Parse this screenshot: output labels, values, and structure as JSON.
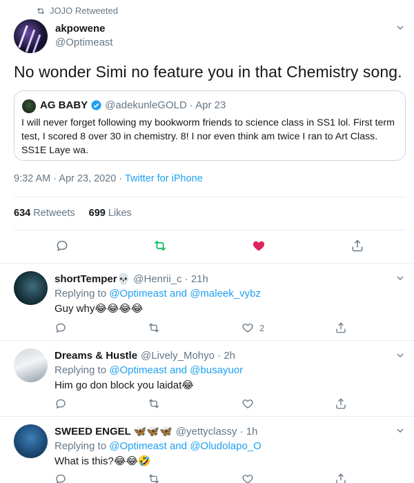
{
  "retweet_context": {
    "text": "JOJO Retweeted",
    "icon": "retweet-icon"
  },
  "tweet": {
    "author_name": "akpowene",
    "author_handle": "@Optimeast",
    "text": "No wonder Simi no feature you in that Chemistry song.",
    "quote": {
      "name": "AG BABY",
      "handle": "@adekunleGOLD",
      "date": "· Apr 23",
      "text": "I will never forget following my bookworm friends to science class in SS1 lol. First term test, I scored 8 over 30 in chemistry. 8! I nor even think am twice I ran to Art Class. SS1E Laye wa."
    },
    "timestamp": "9:32 AM · Apr 23, 2020 · ",
    "source": "Twitter for iPhone",
    "retweets_count": "634",
    "retweets_label": "Retweets",
    "likes_count": "699",
    "likes_label": "Likes",
    "liked": true,
    "retweeted": true,
    "colors": {
      "accent": "#1da1f2",
      "like": "#e0245e",
      "retweet": "#17bf63",
      "muted": "#657786"
    }
  },
  "replies": [
    {
      "name": "shortTemper💀",
      "handle": "@Henrii_c · 21h",
      "replying_prefix": "Replying to ",
      "mention1": "@Optimeast",
      "and": " and ",
      "mention2": "@maleek_vybz",
      "text": "Guy why😂😂😂😂",
      "likes": "2"
    },
    {
      "name": "Dreams & Hustle",
      "handle": "@Lively_Mohyo · 2h",
      "replying_prefix": "Replying to ",
      "mention1": "@Optimeast",
      "and": " and ",
      "mention2": "@busayuor",
      "text": "Him go don block you laidat😂",
      "likes": ""
    },
    {
      "name": "SWEED ENGEL 🦋🦋🦋",
      "handle": "@yettyclassy · 1h",
      "replying_prefix": "Replying to ",
      "mention1": "@Optimeast",
      "and": " and ",
      "mention2": "@Oludolapo_O",
      "text": "What is this?😂😂🤣",
      "likes": ""
    }
  ]
}
